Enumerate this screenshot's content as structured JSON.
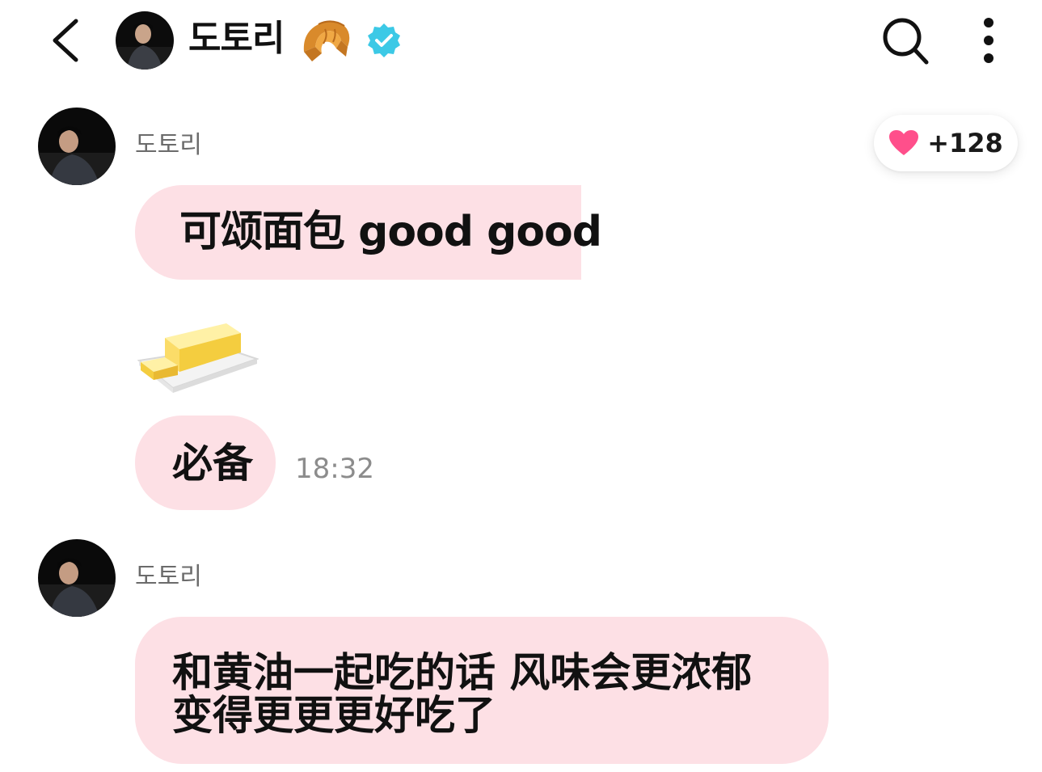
{
  "header": {
    "title": "도토리",
    "back_icon": "chevron-left-icon",
    "croissant_icon": "croissant-emoji",
    "verified_icon": "verified-badge-icon",
    "search_icon": "search-icon",
    "more_icon": "more-vertical-icon"
  },
  "messages": [
    {
      "sender": "도토리",
      "bubbles": [
        {
          "text": "可颂面包 good good"
        },
        {
          "emoji": "butter-emoji"
        },
        {
          "text": "必备",
          "time": "18:32"
        }
      ],
      "reaction": {
        "icon": "heart-icon",
        "count": "+128"
      }
    },
    {
      "sender": "도토리",
      "bubbles": [
        {
          "text": "和黄油一起吃的话 风味会更浓郁\n变得更更更好吃了"
        }
      ]
    }
  ],
  "colors": {
    "bubble": "#fde0e5",
    "verified": "#3cc9e6",
    "heart": "#ff4f8b",
    "timestamp": "#8c8c8c",
    "sender_name": "#6b6b6b"
  }
}
